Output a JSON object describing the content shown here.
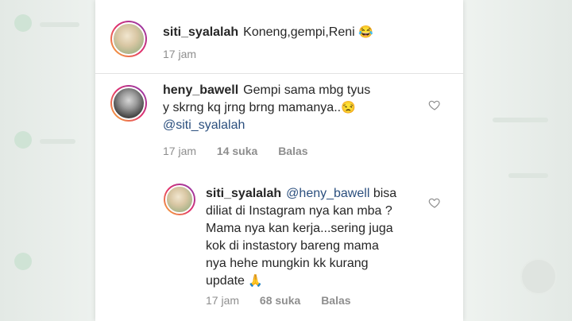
{
  "comments": [
    {
      "username": "siti_syalalah",
      "body": "Koneng,gempi,Reni",
      "emoji": "😂",
      "time": "17 jam"
    },
    {
      "username": "heny_bawell",
      "line1": "Gempi sama mbg tyus",
      "line2": "y skrng kq jrng brng mamanya..",
      "emoji": "😒",
      "mention": "@siti_syalalah",
      "time": "17 jam",
      "likes": "14 suka",
      "reply": "Balas"
    },
    {
      "username": "siti_syalalah",
      "mention": "@heny_bawell",
      "line1_rest": "bisa",
      "line2": "diliat di Instagram nya kan mba ?",
      "line3": "Mama nya kan kerja...sering juga",
      "line4": "kok di instastory bareng mama",
      "line5": "nya hehe mungkin kk kurang",
      "line6": "update",
      "emoji": "🙏",
      "time": "17 jam",
      "likes": "68 suka",
      "reply": "Balas"
    }
  ],
  "icons": {
    "like": "heart-outline-icon"
  },
  "colors": {
    "mention": "#2b4f7e",
    "meta": "#8e8e8e"
  }
}
